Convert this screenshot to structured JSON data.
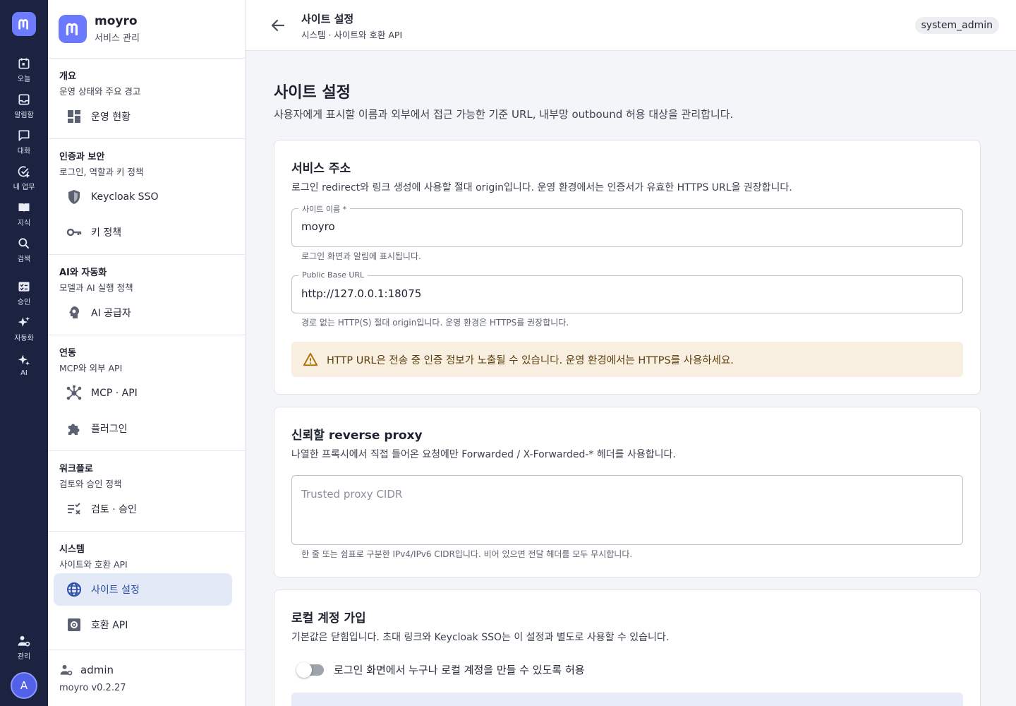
{
  "rail": {
    "items": [
      {
        "label": "오늘",
        "icon": "calendar-icon"
      },
      {
        "label": "알림함",
        "icon": "inbox-icon"
      },
      {
        "label": "대화",
        "icon": "chat-icon"
      },
      {
        "label": "내 업무",
        "icon": "task-check-icon"
      },
      {
        "label": "지식",
        "icon": "book-icon"
      },
      {
        "label": "검색",
        "icon": "search-icon"
      },
      {
        "label": "승인",
        "icon": "approval-icon"
      },
      {
        "label": "자동화",
        "icon": "sparkle-icon"
      },
      {
        "label": "AI",
        "icon": "ai-sparkle-icon"
      }
    ],
    "admin_label": "관리",
    "avatar_initial": "A"
  },
  "brand": {
    "name": "moyro",
    "subtitle": "서비스 관리"
  },
  "groups": [
    {
      "title": "개요",
      "desc": "운영 상태와 주요 경고",
      "items": [
        {
          "label": "운영 현황",
          "icon": "dashboard-icon"
        }
      ]
    },
    {
      "title": "인증과 보안",
      "desc": "로그인, 역할과 키 정책",
      "items": [
        {
          "label": "Keycloak SSO",
          "icon": "shield-icon"
        },
        {
          "label": "키 정책",
          "icon": "key-icon"
        }
      ]
    },
    {
      "title": "AI와 자동화",
      "desc": "모델과 AI 실행 정책",
      "items": [
        {
          "label": "AI 공급자",
          "icon": "ai-provider-icon"
        }
      ]
    },
    {
      "title": "연동",
      "desc": "MCP와 외부 API",
      "items": [
        {
          "label": "MCP · API",
          "icon": "hub-icon"
        },
        {
          "label": "플러그인",
          "icon": "puzzle-icon"
        }
      ]
    },
    {
      "title": "워크플로",
      "desc": "검토와 승인 정책",
      "items": [
        {
          "label": "검토 · 승인",
          "icon": "checklist-icon"
        }
      ]
    },
    {
      "title": "시스템",
      "desc": "사이트와 호환 API",
      "items": [
        {
          "label": "사이트 설정",
          "icon": "globe-icon",
          "active": true
        },
        {
          "label": "호환 API",
          "icon": "settings-box-icon"
        }
      ]
    }
  ],
  "footer": {
    "user": "admin",
    "version": "moyro v0.2.27"
  },
  "header": {
    "title": "사이트 설정",
    "breadcrumb": "시스템 · 사이트와 호환 API",
    "role": "system_admin"
  },
  "page": {
    "title": "사이트 설정",
    "description": "사용자에게 표시할 이름과 외부에서 접근 가능한 기준 URL, 내부망 outbound 허용 대상을 관리합니다."
  },
  "service_address": {
    "title": "서비스 주소",
    "description": "로그인 redirect와 링크 생성에 사용할 절대 origin입니다. 운영 환경에서는 인증서가 유효한 HTTPS URL을 권장합니다.",
    "site_name": {
      "label": "사이트 이름 *",
      "value": "moyro",
      "helper": "로그인 화면과 알림에 표시됩니다."
    },
    "base_url": {
      "label": "Public Base URL",
      "value": "http://127.0.0.1:18075",
      "helper": "경로 없는 HTTP(S) 절대 origin입니다. 운영 환경은 HTTPS를 권장합니다."
    },
    "warning": "HTTP URL은 전송 중 인증 정보가 노출될 수 있습니다. 운영 환경에서는 HTTPS를 사용하세요."
  },
  "reverse_proxy": {
    "title": "신뢰할 reverse proxy",
    "description": "나열한 프록시에서 직접 들어온 요청에만 Forwarded / X-Forwarded-* 헤더를 사용합니다.",
    "placeholder": "Trusted proxy CIDR",
    "helper": "한 줄 또는 쉼표로 구분한 IPv4/IPv6 CIDR입니다. 비어 있으면 전달 헤더를 모두 무시합니다."
  },
  "local_signup": {
    "title": "로컬 계정 가입",
    "description": "기본값은 닫힘입니다. 초대 링크와 Keycloak SSO는 이 설정과 별도로 사용할 수 있습니다.",
    "toggle_label": "로그인 화면에서 누구나 로컬 계정을 만들 수 있도록 허용",
    "enabled": false
  },
  "colors": {
    "rail": "#1c2340",
    "accent": "#6b79ff",
    "active_bg": "#e3e9f6",
    "warning_bg": "#f8efe1"
  }
}
